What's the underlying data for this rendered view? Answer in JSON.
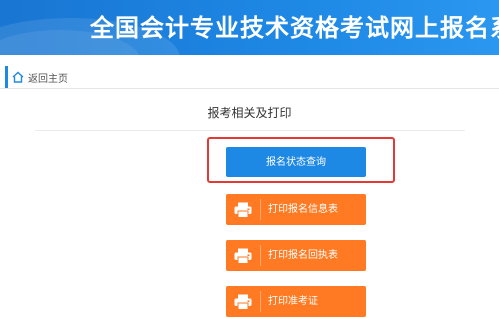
{
  "header": {
    "title": "全国会计专业技术资格考试网上报名系统"
  },
  "nav": {
    "back_label": "返回主页"
  },
  "page": {
    "section_title": "报考相关及打印"
  },
  "buttons": {
    "status_query": "报名状态查询",
    "print_info": "打印报名信息表",
    "print_receipt": "打印报名回执表",
    "print_admission": "打印准考证"
  },
  "colors": {
    "header_blue": "#1e88e5",
    "button_blue": "#1e88e5",
    "button_orange": "#ff7a22",
    "highlight_red": "#e53935"
  },
  "icons": {
    "home": "home-icon",
    "printer": "printer-icon"
  }
}
